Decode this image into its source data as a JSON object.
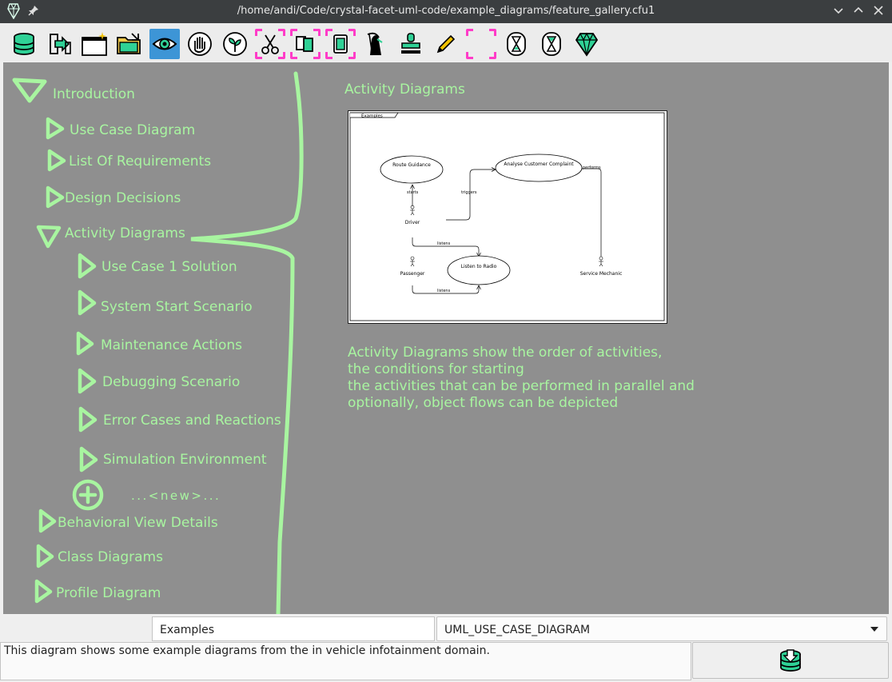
{
  "window": {
    "title": "/home/andi/Code/crystal-facet-uml-code/example_diagrams/feature_gallery.cfu1",
    "app_icon": "crystal-facet-diamond-icon",
    "buttons": [
      "pin-icon",
      "minimize-icon",
      "maximize-icon",
      "close-icon"
    ]
  },
  "toolbar": {
    "tools": [
      {
        "name": "open-database-tool",
        "icon": "database-icon"
      },
      {
        "name": "export-tool",
        "icon": "export-icon"
      },
      {
        "name": "new-window-tool",
        "icon": "new-window-icon"
      },
      {
        "name": "navigate-tool",
        "icon": "folder-navigate-icon"
      },
      {
        "name": "view-tool",
        "icon": "eye-icon",
        "active": true
      },
      {
        "name": "edit-tool",
        "icon": "hand-icon"
      },
      {
        "name": "create-tool",
        "icon": "seedling-icon"
      },
      {
        "name": "cut-tool",
        "icon": "scissors-icon"
      },
      {
        "name": "copy-tool",
        "icon": "copy-icon"
      },
      {
        "name": "paste-tool",
        "icon": "paste-icon"
      },
      {
        "name": "delete-tool",
        "icon": "grim-reaper-icon"
      },
      {
        "name": "instantiate-tool",
        "icon": "stamp-icon"
      },
      {
        "name": "highlight-tool",
        "icon": "pencil-icon"
      },
      {
        "name": "reset-selection-tool",
        "icon": "dashed-frame-icon"
      },
      {
        "name": "undo-tool",
        "icon": "hourglass-icon"
      },
      {
        "name": "redo-tool",
        "icon": "hourglass-icon"
      },
      {
        "name": "about-tool",
        "icon": "crystal-icon"
      }
    ]
  },
  "nav": {
    "items": [
      {
        "label": "Introduction",
        "expanded": true
      },
      {
        "label": "Use Case Diagram"
      },
      {
        "label": "List Of Requirements"
      },
      {
        "label": "Design Decisions"
      },
      {
        "label": "Activity Diagrams",
        "expanded": true
      },
      {
        "label": "Use Case 1 Solution"
      },
      {
        "label": "System Start Scenario"
      },
      {
        "label": "Maintenance Actions"
      },
      {
        "label": "Debugging Scenario"
      },
      {
        "label": "Error Cases and Reactions"
      },
      {
        "label": "Simulation Environment"
      },
      {
        "label": "Behavioral View Details"
      },
      {
        "label": "Class Diagrams"
      },
      {
        "label": "Profile Diagram"
      }
    ],
    "new_label": "...<new>..."
  },
  "main": {
    "heading": "Activity Diagrams",
    "diagram": {
      "frame_label": "Examples",
      "use_cases": [
        "Route Guidance",
        "Analyse Customer Complaint",
        "Listen to Radio"
      ],
      "actors": [
        "Driver",
        "Passenger",
        "Service Mechanic"
      ],
      "relations": [
        "starts",
        "triggers",
        "performs",
        "listens",
        "listens"
      ]
    },
    "description": [
      "Activity Diagrams show the order of activities,",
      "the conditions for starting",
      "the activities that can be performed in parallel and",
      "optionally, object flows can be depicted"
    ]
  },
  "bottom": {
    "name_value": "Examples",
    "type_value": "UML_USE_CASE_DIAGRAM",
    "description_value": "This diagram shows some example diagrams from the in vehicle infotainment domain.",
    "commit_icon": "database-commit-icon"
  },
  "colors": {
    "canvas": "#8f8f8f",
    "highlight_green": "#a8f5a0",
    "active_tool": "#3d95d6",
    "dashed_marker": "#ff3cc8"
  }
}
